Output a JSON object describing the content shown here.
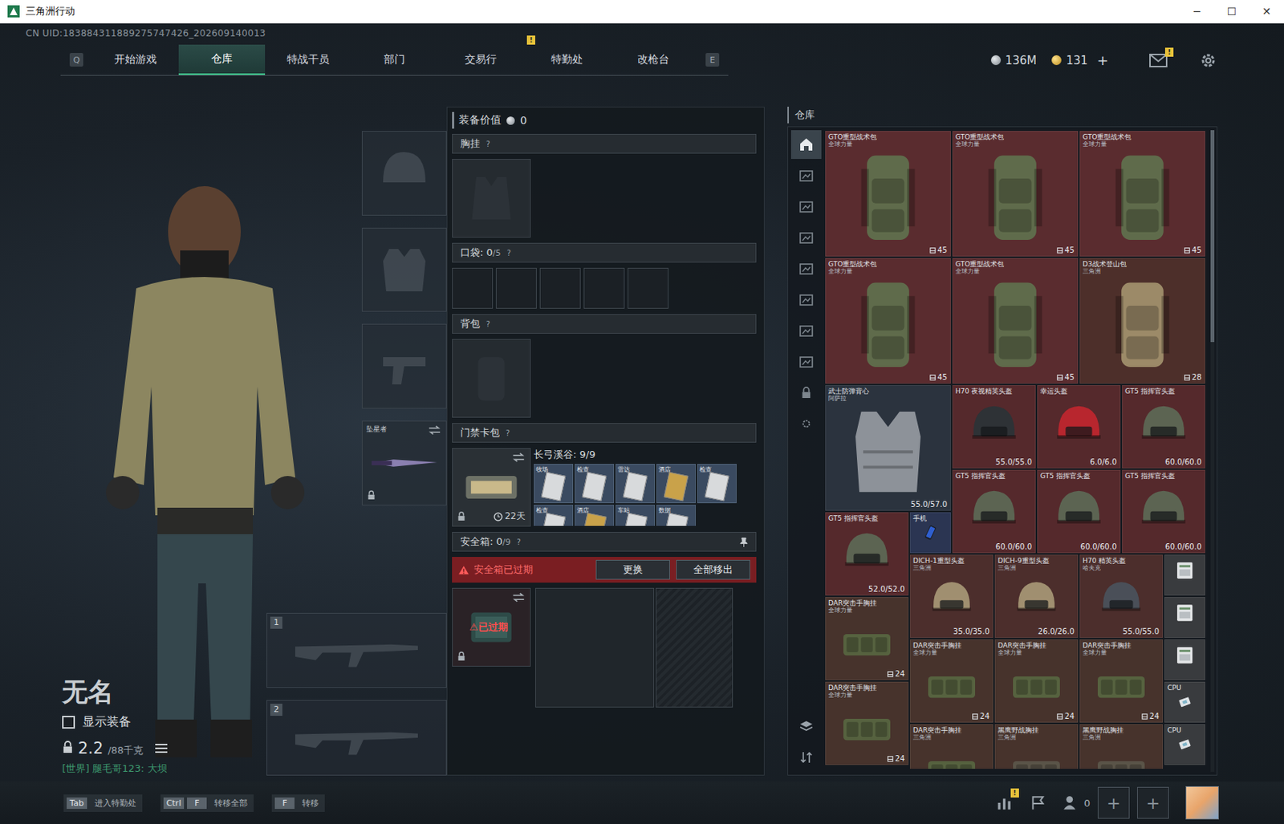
{
  "window": {
    "title": "三角洲行动",
    "controls": [
      "─",
      "☐",
      "✕"
    ]
  },
  "uid": "CN UID:183884311889275747426_202609140013",
  "nav": {
    "left_key": "Q",
    "right_key": "E",
    "tabs": [
      {
        "label": "开始游戏",
        "selected": false,
        "badge": ""
      },
      {
        "label": "仓库",
        "selected": true,
        "badge": ""
      },
      {
        "label": "特战干员",
        "selected": false,
        "badge": ""
      },
      {
        "label": "部门",
        "selected": false,
        "badge": ""
      },
      {
        "label": "交易行",
        "selected": false,
        "badge": ""
      },
      {
        "label": "特勤处",
        "selected": false,
        "badge": "!"
      },
      {
        "label": "改枪台",
        "selected": false,
        "badge": ""
      }
    ]
  },
  "currency": {
    "coins": "136M",
    "premium": "131",
    "add": "+"
  },
  "mail_badge": "!",
  "character": {
    "name": "无名",
    "show_equipment": {
      "label": "显示装备",
      "checked": false
    },
    "weight": "2.2",
    "weight_max": "/88千克",
    "chat": "[世界] 腿毛哥123: 大坝"
  },
  "slots": [
    {
      "kind": "helmet",
      "name": "",
      "locked": false
    },
    {
      "kind": "armor",
      "name": "",
      "locked": false
    },
    {
      "kind": "pistol",
      "name": "",
      "locked": false
    },
    {
      "kind": "melee",
      "name": "坠星者",
      "locked": true
    }
  ],
  "weapon_slots": [
    {
      "number": "1"
    },
    {
      "number": "2"
    }
  ],
  "loadout": {
    "value_label": "装备价值",
    "value": "0",
    "chest_rig": {
      "title": "胸挂",
      "help": "?"
    },
    "pockets": {
      "title": "口袋:",
      "count": "0",
      "max": "/5",
      "help": "?",
      "slots": 5
    },
    "backpack": {
      "title": "背包",
      "help": "?"
    },
    "card_pack": {
      "title": "门禁卡包",
      "help": "?",
      "map": "长弓溪谷: 9/9",
      "days": "22天",
      "cards": [
        {
          "label": "牧场",
          "color": "#d8dadc"
        },
        {
          "label": "检查",
          "color": "#d8dadc"
        },
        {
          "label": "雷达",
          "color": "#d8dadc"
        },
        {
          "label": "酒店",
          "color": "#c9a24a"
        },
        {
          "label": "检查",
          "color": "#d8dadc"
        },
        {
          "label": "检查",
          "color": "#d8dadc"
        },
        {
          "label": "酒店",
          "color": "#c9a24a"
        },
        {
          "label": "车站",
          "color": "#d8dadc"
        },
        {
          "label": "数据",
          "color": "#d8dadc"
        }
      ]
    },
    "safe_box": {
      "title": "安全箱:",
      "count": "0",
      "max": "/9",
      "help": "?",
      "warning": "安全箱已过期",
      "buttons": [
        "更换",
        "全部移出"
      ],
      "badge": "已过期",
      "expired": true
    }
  },
  "warehouse": {
    "title": "仓库",
    "tabs": [
      {
        "kind": "home",
        "selected": true
      },
      {
        "kind": "storage",
        "selected": false
      },
      {
        "kind": "storage",
        "selected": false
      },
      {
        "kind": "storage",
        "selected": false
      },
      {
        "kind": "storage",
        "selected": false
      },
      {
        "kind": "storage",
        "selected": false
      },
      {
        "kind": "storage",
        "selected": false
      },
      {
        "kind": "storage",
        "selected": false
      },
      {
        "kind": "lock",
        "selected": false
      },
      {
        "kind": "gear",
        "selected": false
      }
    ],
    "tools": [
      {
        "kind": "layers"
      },
      {
        "kind": "sort"
      }
    ],
    "items": [
      {
        "name": "GTO重型战术包",
        "sub": "全球力量",
        "value": "45",
        "kind": "backpack",
        "w": 3,
        "h": 3,
        "color": "#5a2c2f",
        "tint": "#5f6b4b"
      },
      {
        "name": "GTO重型战术包",
        "sub": "全球力量",
        "value": "45",
        "kind": "backpack",
        "w": 3,
        "h": 3,
        "color": "#5a2c2f",
        "tint": "#5f6b4b"
      },
      {
        "name": "GTO重型战术包",
        "sub": "全球力量",
        "value": "45",
        "kind": "backpack",
        "w": 3,
        "h": 3,
        "color": "#5a2c2f",
        "tint": "#5f6b4b"
      },
      {
        "name": "GTO重型战术包",
        "sub": "全球力量",
        "value": "45",
        "kind": "backpack",
        "w": 3,
        "h": 3,
        "color": "#5a2c2f",
        "tint": "#5f6b4b"
      },
      {
        "name": "GTO重型战术包",
        "sub": "全球力量",
        "value": "45",
        "kind": "backpack",
        "w": 3,
        "h": 3,
        "color": "#5a2c2f",
        "tint": "#5f6b4b"
      },
      {
        "name": "D3战术登山包",
        "sub": "三角洲",
        "value": "28",
        "kind": "backpack",
        "w": 3,
        "h": 3,
        "color": "#4d2f2a",
        "tint": "#9c8a68"
      },
      {
        "name": "武士防弹背心",
        "sub": "阿萨拉",
        "value": "55.0/57.0",
        "kind": "vest",
        "w": 3,
        "h": 3,
        "color": "#2b333e",
        "tint": "#8d9299"
      },
      {
        "name": "H70 夜视精英头盔",
        "sub": "",
        "value": "55.0/55.0",
        "kind": "helmet",
        "w": 2,
        "h": 2,
        "color": "#55292c",
        "tint": "#2e3236"
      },
      {
        "name": "幸运头盔",
        "sub": "",
        "value": "6.0/6.0",
        "kind": "helmet",
        "w": 2,
        "h": 2,
        "color": "#55292c",
        "tint": "#b8262e"
      },
      {
        "name": "GT5 指挥官头盔",
        "sub": "",
        "value": "60.0/60.0",
        "kind": "helmet",
        "w": 2,
        "h": 2,
        "color": "#55292c",
        "tint": "#5c6452"
      },
      {
        "name": "GT5 指挥官头盔",
        "sub": "",
        "value": "60.0/60.0",
        "kind": "helmet",
        "w": 2,
        "h": 2,
        "color": "#55292c",
        "tint": "#5c6452"
      },
      {
        "name": "GT5 指挥官头盔",
        "sub": "",
        "value": "60.0/60.0",
        "kind": "helmet",
        "w": 2,
        "h": 2,
        "color": "#55292c",
        "tint": "#5c6452"
      },
      {
        "name": "GT5 指挥官头盔",
        "sub": "",
        "value": "60.0/60.0",
        "kind": "helmet",
        "w": 2,
        "h": 2,
        "color": "#55292c",
        "tint": "#5c6452"
      },
      {
        "name": "GT5 指挥官头盔",
        "sub": "",
        "value": "52.0/52.0",
        "kind": "helmet",
        "w": 2,
        "h": 2,
        "color": "#55292c",
        "tint": "#5c6452"
      },
      {
        "name": "手机",
        "sub": "",
        "value": "",
        "kind": "phone",
        "w": 1,
        "h": 1,
        "color": "#2b3552",
        "tint": "#2f5fd0"
      },
      {
        "name": "DICH-1重型头盔",
        "sub": "三角洲",
        "value": "35.0/35.0",
        "kind": "helmet",
        "w": 2,
        "h": 2,
        "color": "#4c2e2c",
        "tint": "#a08f70"
      },
      {
        "name": "DICH-9重型头盔",
        "sub": "三角洲",
        "value": "26.0/26.0",
        "kind": "helmet",
        "w": 2,
        "h": 2,
        "color": "#4c2e2c",
        "tint": "#a08f70"
      },
      {
        "name": "H70 精英头盔",
        "sub": "哈夫克",
        "value": "55.0/55.0",
        "kind": "helmet",
        "w": 2,
        "h": 2,
        "color": "#4c2e2c",
        "tint": "#4a4f58"
      },
      {
        "name": "",
        "sub": "",
        "value": "",
        "kind": "device",
        "w": 1,
        "h": 1,
        "color": "#393b3e",
        "tint": "#e4e6e8"
      },
      {
        "name": "DAR突击手胸挂",
        "sub": "全球力量",
        "value": "24",
        "kind": "rig",
        "w": 2,
        "h": 2,
        "color": "#47332c",
        "tint": "#56623f"
      },
      {
        "name": "",
        "sub": "",
        "value": "",
        "kind": "device",
        "w": 1,
        "h": 1,
        "color": "#393b3e",
        "tint": "#e4e6e8"
      },
      {
        "name": "DAR突击手胸挂",
        "sub": "全球力量",
        "value": "24",
        "kind": "rig",
        "w": 2,
        "h": 2,
        "color": "#47332c",
        "tint": "#56623f"
      },
      {
        "name": "DAR突击手胸挂",
        "sub": "全球力量",
        "value": "24",
        "kind": "rig",
        "w": 2,
        "h": 2,
        "color": "#47332c",
        "tint": "#56623f"
      },
      {
        "name": "DAR突击手胸挂",
        "sub": "全球力量",
        "value": "24",
        "kind": "rig",
        "w": 2,
        "h": 2,
        "color": "#47332c",
        "tint": "#56623f"
      },
      {
        "name": "",
        "sub": "",
        "value": "",
        "kind": "device",
        "w": 1,
        "h": 1,
        "color": "#393b3e",
        "tint": "#e4e6e8"
      },
      {
        "name": "DAR突击手胸挂",
        "sub": "全球力量",
        "value": "24",
        "kind": "rig",
        "w": 2,
        "h": 2,
        "color": "#47332c",
        "tint": "#56623f"
      },
      {
        "name": "CPU",
        "sub": "",
        "value": "",
        "kind": "chip",
        "w": 1,
        "h": 1,
        "color": "#393b3e",
        "tint": "#dfe3e6"
      },
      {
        "name": "DAR突击手胸挂",
        "sub": "三角洲",
        "value": "",
        "kind": "rig",
        "w": 2,
        "h": 2,
        "color": "#47332c",
        "tint": "#56623f"
      },
      {
        "name": "黑鹰野战胸挂",
        "sub": "三角洲",
        "value": "",
        "kind": "rig",
        "w": 2,
        "h": 2,
        "color": "#47332c",
        "tint": "#5a5448"
      },
      {
        "name": "黑鹰野战胸挂",
        "sub": "三角洲",
        "value": "",
        "kind": "rig",
        "w": 2,
        "h": 2,
        "color": "#47332c",
        "tint": "#5a5448"
      },
      {
        "name": "CPU",
        "sub": "",
        "value": "",
        "kind": "chip",
        "w": 1,
        "h": 1,
        "color": "#393b3e",
        "tint": "#dfe3e6"
      }
    ]
  },
  "footer": {
    "hints": [
      {
        "keys": [
          "Tab"
        ],
        "label": "进入特勤处"
      },
      {
        "keys": [
          "Ctrl",
          "F"
        ],
        "label": "转移全部"
      },
      {
        "keys": [
          "F"
        ],
        "label": "转移"
      }
    ],
    "stats_badge": "!",
    "friends": "0",
    "add_slots": [
      "+",
      "+"
    ]
  }
}
